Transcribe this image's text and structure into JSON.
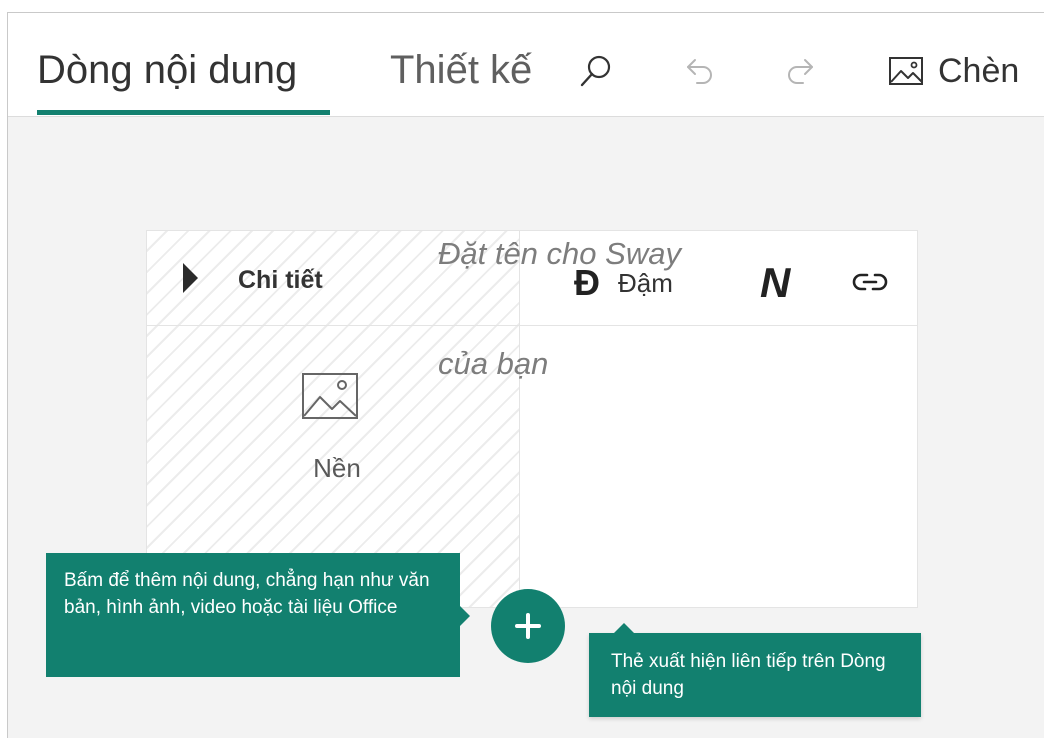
{
  "tabs": {
    "storyline": "Dòng nội dung",
    "design": "Thiết kế"
  },
  "toolbar": {
    "search_icon": "search-icon",
    "undo_icon": "undo-icon",
    "redo_icon": "redo-icon",
    "insert_icon": "image-icon",
    "insert_label": "Chèn"
  },
  "card": {
    "details_label": "Chi tiết",
    "background_label": "Nền",
    "bold_glyph": "Đ",
    "bold_label": "Đậm",
    "italic_glyph": "N",
    "title_placeholder_line1": "Đặt tên cho Sway",
    "title_placeholder_line2": "của bạn"
  },
  "tooltips": {
    "add_content": "Bấm để thêm nội dung, chẳng hạn như văn bản, hình ảnh, video hoặc tài liệu Office",
    "card_sequence": "Thẻ xuất hiện liên tiếp trên Dòng nội dung"
  },
  "colors": {
    "accent": "#12806f",
    "canvas": "#f3f3f3"
  }
}
